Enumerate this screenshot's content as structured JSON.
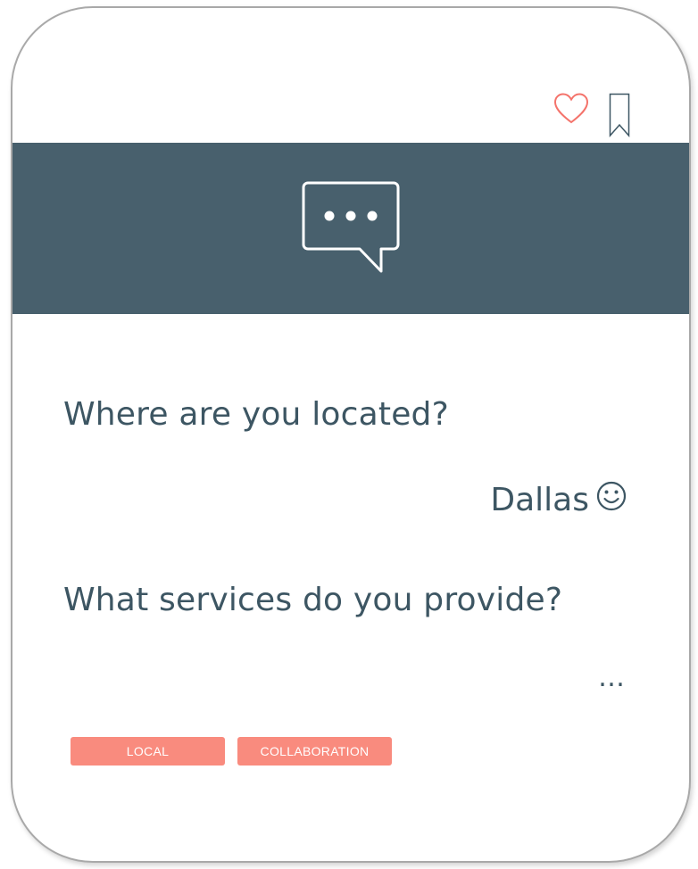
{
  "card": {
    "questions": [
      {
        "question": "Where are you located?",
        "answer": "Dallas",
        "answer_icon": "smiley-face-icon"
      },
      {
        "question": "What services do you provide?",
        "answer": "…"
      }
    ],
    "tags": [
      "LOCAL",
      "COLLABORATION"
    ],
    "header_actions": [
      "heart-icon",
      "bookmark-icon"
    ],
    "banner_icon": "chat-bubble-icon"
  },
  "colors": {
    "banner": "#48606d",
    "text": "#3d5663",
    "tag": "#f98b7e",
    "heart": "#f4736b",
    "bookmark": "#3d5663"
  }
}
